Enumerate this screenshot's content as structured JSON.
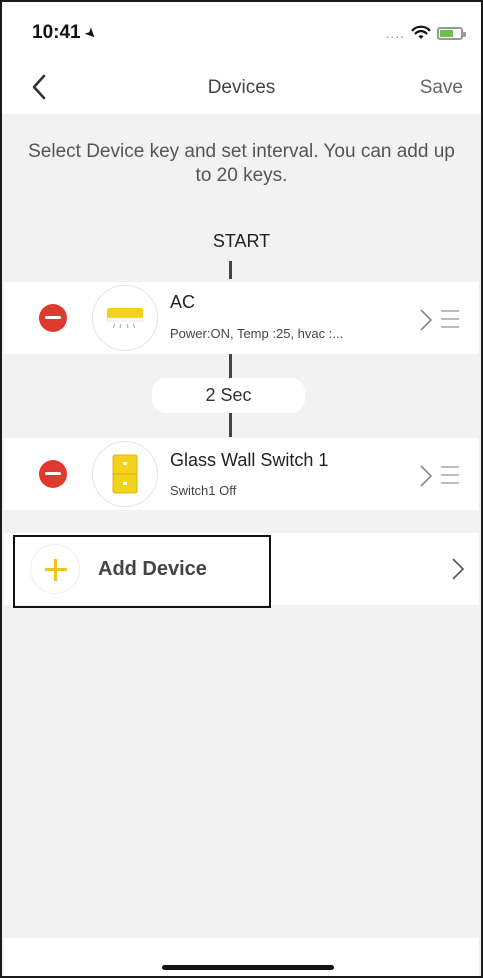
{
  "status_bar": {
    "time": "10:41",
    "location_arrow": "➤",
    "signal": "....",
    "icons": [
      "location-arrow-icon",
      "wifi-icon",
      "battery-icon"
    ]
  },
  "nav": {
    "back_icon": "chevron-left-icon",
    "title": "Devices",
    "save_label": "Save"
  },
  "hint": "Select Device key and set interval. You can add up to 20 keys.",
  "flow": {
    "start_label": "START",
    "devices": [
      {
        "name": "AC",
        "subtitle": "Power:ON, Temp :25, hvac :...",
        "icon": "air-conditioner-icon"
      },
      {
        "name": "Glass Wall Switch 1",
        "subtitle": "Switch1 Off",
        "icon": "wall-switch-icon"
      }
    ],
    "interval_label": "2 Sec"
  },
  "add_device": {
    "label": "Add Device",
    "icon": "plus-icon"
  },
  "colors": {
    "remove": "#e03a2f",
    "accent_yellow": "#f4c21b",
    "background": "#f2f2f2"
  }
}
